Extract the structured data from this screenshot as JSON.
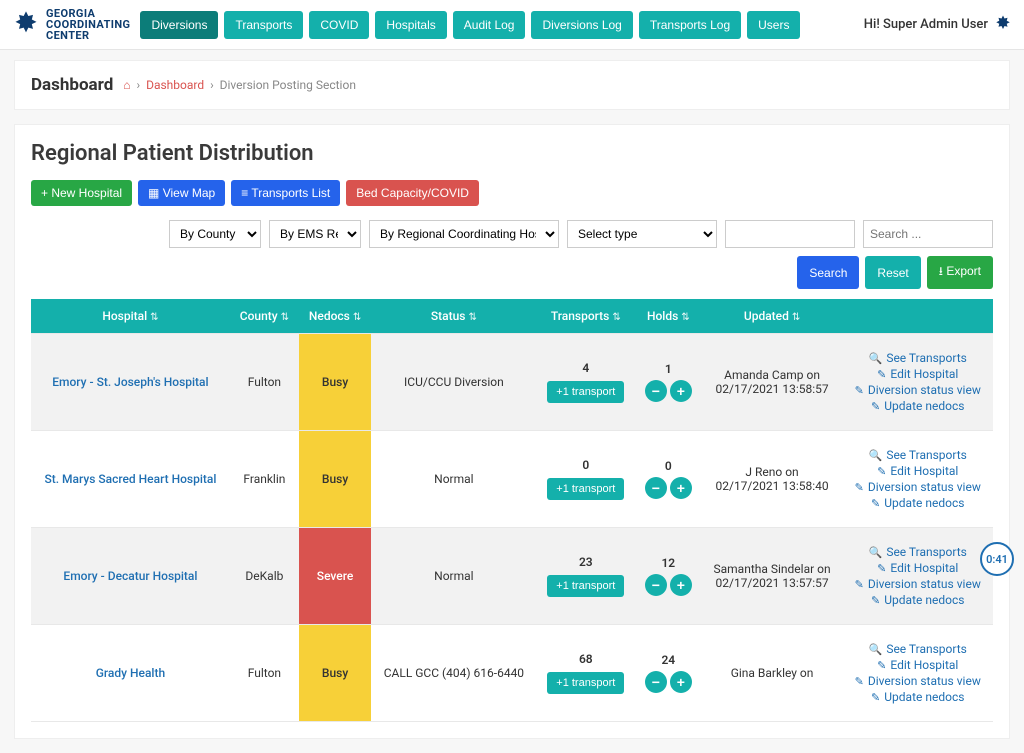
{
  "brand": {
    "line1": "GEORGIA",
    "line2": "COORDINATING",
    "line3": "CENTER"
  },
  "nav": {
    "items": [
      {
        "label": "Diversions",
        "active": true
      },
      {
        "label": "Transports"
      },
      {
        "label": "COVID"
      },
      {
        "label": "Hospitals"
      },
      {
        "label": "Audit Log"
      },
      {
        "label": "Diversions Log"
      },
      {
        "label": "Transports Log"
      },
      {
        "label": "Users"
      }
    ]
  },
  "user": {
    "greeting": "Hi! Super Admin User"
  },
  "breadcrumb": {
    "title": "Dashboard",
    "home_link": "Dashboard",
    "current": "Diversion Posting Section"
  },
  "page": {
    "title": "Regional Patient Distribution",
    "buttons": {
      "new_hospital": "+ New Hospital",
      "view_map": "View Map",
      "transports_list": "Transports List",
      "bed_capacity": "Bed Capacity/COVID"
    }
  },
  "filters": {
    "by_county": "By County",
    "by_ems": "By EMS Region",
    "by_rch": "By Regional Coordinating Hospital",
    "select_type": "Select type",
    "search_placeholder": "Search ..."
  },
  "pills": {
    "search": "Search",
    "reset": "Reset",
    "export": "Export"
  },
  "table": {
    "headers": {
      "hospital": "Hospital",
      "county": "County",
      "nedocs": "Nedocs",
      "status": "Status",
      "transports": "Transports",
      "holds": "Holds",
      "updated": "Updated"
    },
    "row_actions": {
      "see_transports": "See Transports",
      "edit_hospital": "Edit Hospital",
      "diversion_status": "Diversion status view",
      "update_nedocs": "Update nedocs"
    },
    "add_transport_label": "+1 transport",
    "rows": [
      {
        "hospital": "Emory - St. Joseph's Hospital",
        "county": "Fulton",
        "nedocs": "Busy",
        "nedocs_class": "busy",
        "status": "ICU/CCU Diversion",
        "transports": "4",
        "holds": "1",
        "updated_by": "Amanda Camp on",
        "updated_at": "02/17/2021 13:58:57"
      },
      {
        "hospital": "St. Marys Sacred Heart Hospital",
        "county": "Franklin",
        "nedocs": "Busy",
        "nedocs_class": "busy",
        "status": "Normal",
        "transports": "0",
        "holds": "0",
        "updated_by": "J Reno on",
        "updated_at": "02/17/2021 13:58:40"
      },
      {
        "hospital": "Emory - Decatur Hospital",
        "county": "DeKalb",
        "nedocs": "Severe",
        "nedocs_class": "severe",
        "status": "Normal",
        "transports": "23",
        "holds": "12",
        "updated_by": "Samantha Sindelar on",
        "updated_at": "02/17/2021 13:57:57"
      },
      {
        "hospital": "Grady Health",
        "county": "Fulton",
        "nedocs": "Busy",
        "nedocs_class": "busy",
        "status": "CALL GCC (404) 616-6440",
        "transports": "68",
        "holds": "24",
        "updated_by": "Gina Barkley on",
        "updated_at": ""
      }
    ]
  },
  "timer": "0:41"
}
